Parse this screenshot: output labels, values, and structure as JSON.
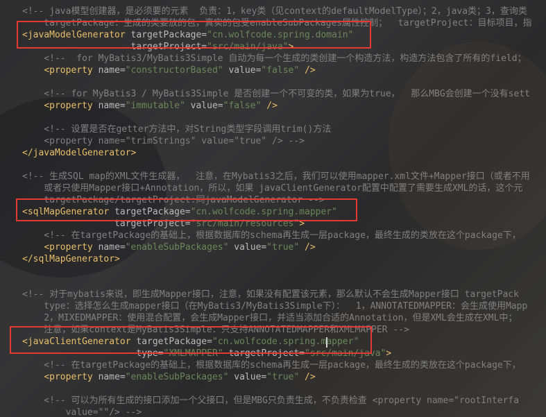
{
  "theme": {
    "background": "#2b2b2b",
    "comment": "#808080",
    "tag": "#e8bf6a",
    "attribute": "#bababa",
    "string": "#6a8759",
    "highlight": "#e53935"
  },
  "lines": [
    [
      [
        "cm",
        "<!-- java模型创建器，是必须要的元素  负责：1，key类（见context的defaultModelType）；2，java类；3，查询类"
      ]
    ],
    [
      [
        "cm",
        "    targetPackage：生成的类要放的包，真实的包受enableSubPackages属性控制；  targetProject：目标项目，指"
      ]
    ],
    [
      [
        "tag",
        "<javaModelGenerator "
      ],
      [
        "attr",
        "targetPackage="
      ],
      [
        "str",
        "\"cn.wolfcode.spring.domain\""
      ]
    ],
    [
      [
        "plain",
        "                    "
      ],
      [
        "attr",
        "targetProject="
      ],
      [
        "str",
        "\"src/main/java\""
      ],
      [
        "tag",
        ">"
      ]
    ],
    [
      [
        "cm",
        "    <!--  for MyBatis3/MyBatis3Simple 自动为每一个生成的类创建一个构造方法，构造方法包含了所有的field；"
      ]
    ],
    [
      [
        "plain",
        "    "
      ],
      [
        "tag",
        "<property "
      ],
      [
        "attr",
        "name="
      ],
      [
        "str",
        "\"constructorBased\""
      ],
      [
        "plain",
        " "
      ],
      [
        "attr",
        "value="
      ],
      [
        "str",
        "\"false\""
      ],
      [
        "plain",
        " "
      ],
      [
        "tag",
        "/>"
      ]
    ],
    [
      [
        "plain",
        ""
      ]
    ],
    [
      [
        "cm",
        "    <!-- for MyBatis3 / MyBatis3Simple 是否创建一个不可变的类，如果为true，  那么MBG会创建一个没有sett"
      ]
    ],
    [
      [
        "plain",
        "    "
      ],
      [
        "tag",
        "<property "
      ],
      [
        "attr",
        "name="
      ],
      [
        "str",
        "\"immutable\""
      ],
      [
        "plain",
        " "
      ],
      [
        "attr",
        "value="
      ],
      [
        "str",
        "\"false\""
      ],
      [
        "plain",
        " "
      ],
      [
        "tag",
        "/>"
      ]
    ],
    [
      [
        "plain",
        ""
      ]
    ],
    [
      [
        "cm",
        "    <!-- 设置是否在getter方法中，对String类型字段调用trim()方法"
      ]
    ],
    [
      [
        "cm",
        "    <property name=\"trimStrings\" value=\"true\" /> -->"
      ]
    ],
    [
      [
        "tag",
        "</javaModelGenerator>"
      ]
    ],
    [
      [
        "plain",
        ""
      ]
    ],
    [
      [
        "cm",
        "<!-- 生成SQL map的XML文件生成器，  注意，在Mybatis3之后，我们可以使用mapper.xml文件+Mapper接口（或者不用"
      ]
    ],
    [
      [
        "cm",
        "    或者只使用Mapper接口+Annotation，所以，如果 javaClientGenerator配置中配置了需要生成XML的话，这个元"
      ]
    ],
    [
      [
        "cm",
        "    targetPackage/targetProject:同javaModelGenerator -->"
      ]
    ],
    [
      [
        "tag",
        "<sqlMapGenerator "
      ],
      [
        "attr",
        "targetPackage="
      ],
      [
        "str",
        "\"cn.wolfcode.spring.mapper\""
      ]
    ],
    [
      [
        "plain",
        "                 "
      ],
      [
        "attr",
        "targetProject="
      ],
      [
        "str",
        "\"src/main/resources\""
      ],
      [
        "tag",
        ">"
      ]
    ],
    [
      [
        "cm",
        "    <!-- 在targetPackage的基础上，根据数据库的schema再生成一层package，最终生成的类放在这个package下，"
      ]
    ],
    [
      [
        "plain",
        "    "
      ],
      [
        "tag",
        "<property "
      ],
      [
        "attr",
        "name="
      ],
      [
        "str",
        "\"enableSubPackages\""
      ],
      [
        "plain",
        " "
      ],
      [
        "attr",
        "value="
      ],
      [
        "str",
        "\"true\""
      ],
      [
        "plain",
        " "
      ],
      [
        "tag",
        "/>"
      ]
    ],
    [
      [
        "tag",
        "</sqlMapGenerator>"
      ]
    ],
    [
      [
        "plain",
        ""
      ]
    ],
    [
      [
        "plain",
        ""
      ]
    ],
    [
      [
        "cm",
        "<!-- 对于mybatis来说，即生成Mapper接口，注意，如果没有配置该元素，那么默认不会生成Mapper接口 targetPack"
      ]
    ],
    [
      [
        "cm",
        "    type：选择怎么生成mapper接口（在MyBatis3/MyBatis3Simple下）：  1，ANNOTATEDMAPPER：会生成使用Mapp"
      ]
    ],
    [
      [
        "cm",
        "    2，MIXEDMAPPER：使用混合配置，会生成Mapper接口，并适当添加合适的Annotation，但是XML会生成在XML中；"
      ]
    ],
    [
      [
        "cm",
        "    注意，如果context是MyBatis3Simple：只支持ANNOTATEDMAPPER和XMLMAPPER -->"
      ]
    ],
    [
      [
        "tag",
        "<javaClientGenerator "
      ],
      [
        "attr",
        "targetPackage="
      ],
      [
        "str",
        "\"cn.wolfcode.spring.mapper\""
      ]
    ],
    [
      [
        "plain",
        "                     "
      ],
      [
        "attr",
        "type="
      ],
      [
        "str",
        "\"XMLMAPPER\""
      ],
      [
        "plain",
        " "
      ],
      [
        "attr",
        "targetProject="
      ],
      [
        "str",
        "\"src/main/java\""
      ],
      [
        "tag",
        ">"
      ]
    ],
    [
      [
        "cm",
        "    <!-- 在targetPackage的基础上，根据数据库的schema再生成一层package，最终生成的类放在这个package下，"
      ]
    ],
    [
      [
        "plain",
        "    "
      ],
      [
        "tag",
        "<property "
      ],
      [
        "attr",
        "name="
      ],
      [
        "str",
        "\"enableSubPackages\""
      ],
      [
        "plain",
        " "
      ],
      [
        "attr",
        "value="
      ],
      [
        "str",
        "\"true\""
      ],
      [
        "plain",
        " "
      ],
      [
        "tag",
        "/>"
      ]
    ],
    [
      [
        "plain",
        ""
      ]
    ],
    [
      [
        "cm",
        "    <!-- 可以为所有生成的接口添加一个父接口，但是MBG只负责生成，不负责检查 <property name=\"rootInterfa"
      ]
    ],
    [
      [
        "cm",
        "        value=\"\"/> -->"
      ]
    ]
  ]
}
